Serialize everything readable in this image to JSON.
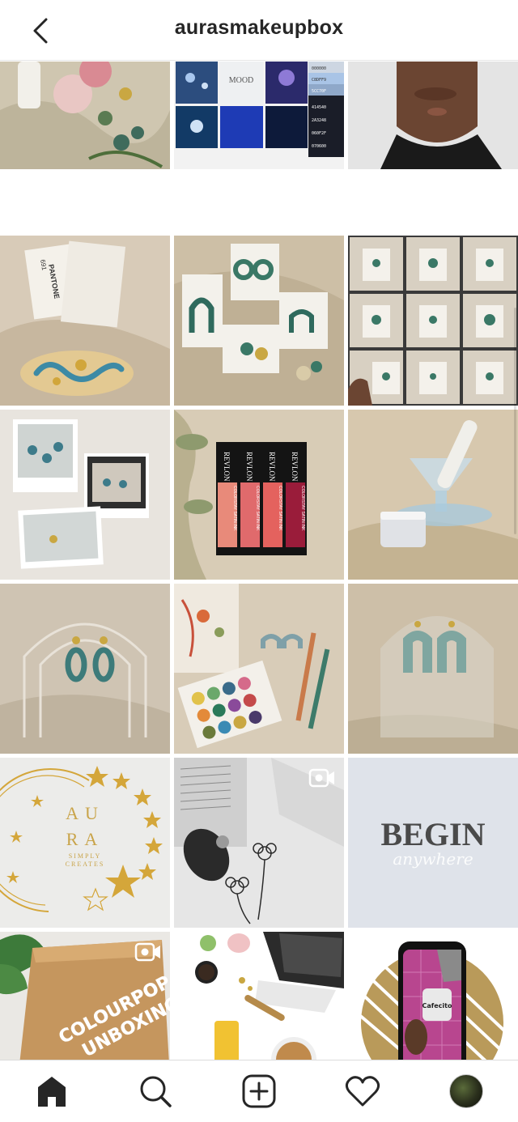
{
  "header": {
    "title": "aurasmakeupbox",
    "back_icon": "chevron-left-icon"
  },
  "palette": {
    "text": "#262626",
    "divider": "#dbdbdb",
    "gold": "#d4a63a",
    "slate": "#4a4a4a"
  },
  "posts": [
    {
      "label": "Skincare products and clay earrings on linen",
      "video": false
    },
    {
      "label": "Mood board colour palette",
      "video": false,
      "texts": {
        "swatches": [
          "000000",
          "C8DFF9",
          "5CC70F",
          "414540",
          "2A3248",
          "060F2F",
          "070600"
        ]
      }
    },
    {
      "label": "Close-up portrait",
      "video": false
    },
    {
      "label": "Pantone cards and resin tray",
      "video": false,
      "texts": {
        "pantone": "PANTONE",
        "code": "691"
      }
    },
    {
      "label": "Green clay earrings on cards",
      "video": false
    },
    {
      "label": "Earring collage grid",
      "video": false
    },
    {
      "label": "Polaroid earring collage",
      "video": false
    },
    {
      "label": "Revlon ColorStay Satin Ink lipsticks",
      "video": false,
      "texts": {
        "brand": "REVLON",
        "line": "COLORSTAY SATIN INK"
      }
    },
    {
      "label": "Glass dish with jar",
      "video": false
    },
    {
      "label": "Arch earring display",
      "video": false
    },
    {
      "label": "Eyeshadow palette and pencils",
      "video": false
    },
    {
      "label": "Arch earrings on acrylic stand",
      "video": false
    },
    {
      "label": "Aura Simply Creates logo",
      "video": false,
      "texts": {
        "line1": "AU",
        "line2": "RA",
        "line3": "SIMPLY",
        "line4": "CREATES"
      }
    },
    {
      "label": "Flower sketch with earring",
      "video": true
    },
    {
      "label": "Begin anywhere quote",
      "video": false,
      "texts": {
        "main": "BEGIN",
        "script": "anywhere"
      }
    },
    {
      "label": "Colourpop unboxing",
      "video": true,
      "texts": {
        "line1": "COLOURPOP",
        "line2": "UNBOXING"
      }
    },
    {
      "label": "Desk flatlay with laptop",
      "video": false
    },
    {
      "label": "Phone with sticker",
      "video": true,
      "texts": {
        "sticker": "Cafecito"
      }
    }
  ],
  "bottom_nav": [
    {
      "name": "home-icon"
    },
    {
      "name": "search-icon"
    },
    {
      "name": "new-post-icon"
    },
    {
      "name": "activity-heart-icon"
    },
    {
      "name": "profile-avatar"
    }
  ]
}
